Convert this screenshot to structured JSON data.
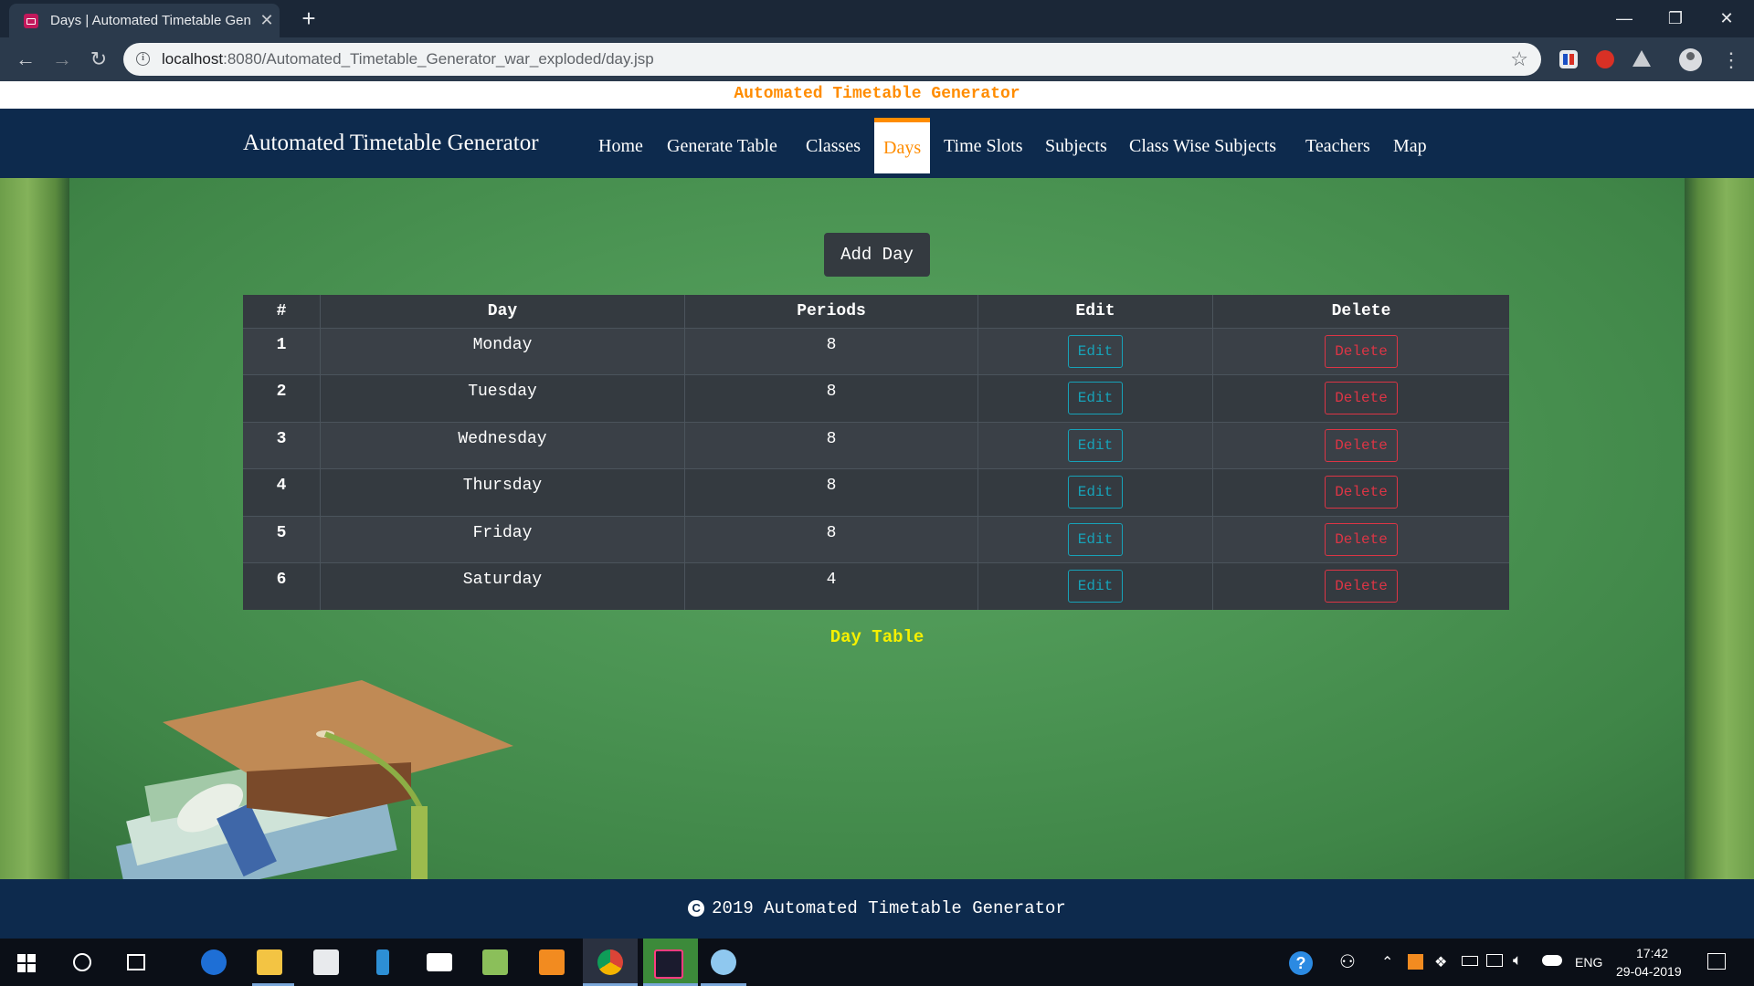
{
  "browser": {
    "tab_title": "Days | Automated Timetable Generator",
    "tab_close": "✕",
    "new_tab": "+",
    "url_host": "localhost",
    "url_rest": ":8080/Automated_Timetable_Generator_war_exploded/day.jsp",
    "window": {
      "minimize": "—",
      "restore": "❐",
      "close": "✕"
    }
  },
  "page": {
    "banner": "Automated Timetable Generator",
    "brand": "Automated Timetable Generator",
    "nav": [
      {
        "label": "Home"
      },
      {
        "label": "Generate Table"
      },
      {
        "label": "Classes"
      },
      {
        "label": "Days",
        "active": true
      },
      {
        "label": "Time Slots"
      },
      {
        "label": "Subjects"
      },
      {
        "label": "Class Wise Subjects"
      },
      {
        "label": "Teachers"
      },
      {
        "label": "Map"
      }
    ],
    "add_button": "Add Day",
    "table": {
      "headers": [
        "#",
        "Day",
        "Periods",
        "Edit",
        "Delete"
      ],
      "rows": [
        {
          "num": "1",
          "day": "Monday",
          "periods": "8",
          "edit": "Edit",
          "delete": "Delete"
        },
        {
          "num": "2",
          "day": "Tuesday",
          "periods": "8",
          "edit": "Edit",
          "delete": "Delete"
        },
        {
          "num": "3",
          "day": "Wednesday",
          "periods": "8",
          "edit": "Edit",
          "delete": "Delete"
        },
        {
          "num": "4",
          "day": "Thursday",
          "periods": "8",
          "edit": "Edit",
          "delete": "Delete"
        },
        {
          "num": "5",
          "day": "Friday",
          "periods": "8",
          "edit": "Edit",
          "delete": "Delete"
        },
        {
          "num": "6",
          "day": "Saturday",
          "periods": "4",
          "edit": "Edit",
          "delete": "Delete"
        }
      ]
    },
    "caption": "Day Table",
    "footer": "2019 Automated Timetable Generator",
    "footer_symbol": "C",
    "colors": {
      "accent": "#ff8c00",
      "navbar": "#0d2a4d",
      "board": "#4a9352",
      "caption": "#f5f000"
    }
  },
  "taskbar": {
    "language": "ENG",
    "time": "17:42",
    "date": "29-04-2019"
  }
}
